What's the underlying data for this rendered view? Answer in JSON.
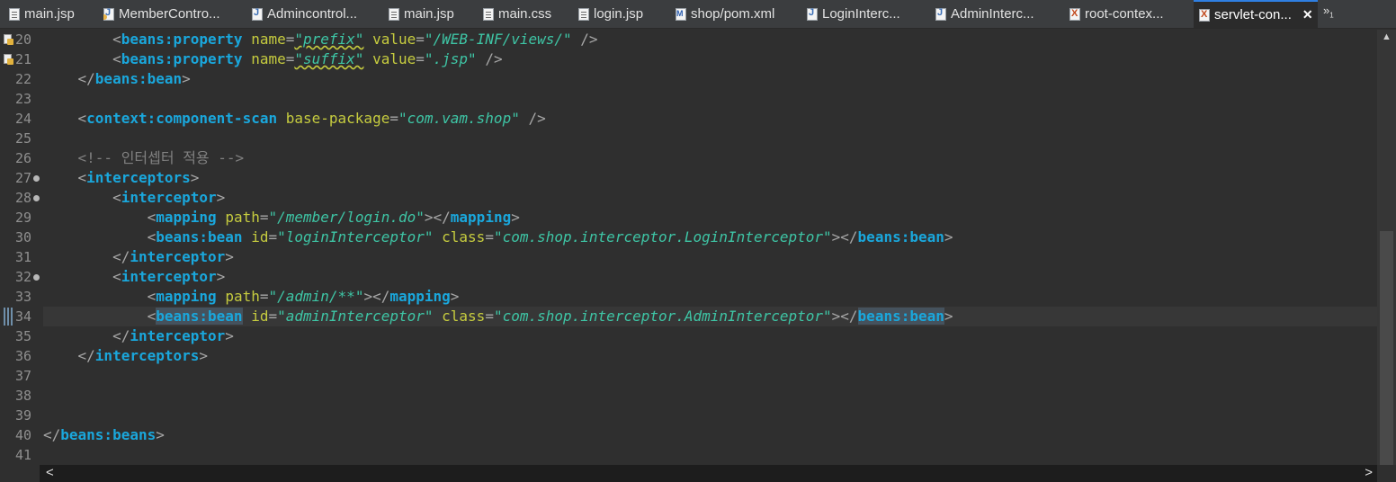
{
  "tabs": [
    {
      "label": "main.jsp",
      "icon": "jsp-file-icon"
    },
    {
      "label": "MemberContro...",
      "icon": "java-file-icon"
    },
    {
      "label": "Admincontrol...",
      "icon": "java-file-icon"
    },
    {
      "label": "main.jsp",
      "icon": "jsp-file-icon"
    },
    {
      "label": "main.css",
      "icon": "css-file-icon"
    },
    {
      "label": "login.jsp",
      "icon": "jsp-file-icon"
    },
    {
      "label": "shop/pom.xml",
      "icon": "maven-pom-icon"
    },
    {
      "label": "LoginInterc...",
      "icon": "java-file-icon"
    },
    {
      "label": "AdminInterc...",
      "icon": "java-file-icon"
    },
    {
      "label": "root-contex...",
      "icon": "xml-file-icon"
    },
    {
      "label": "servlet-con...",
      "icon": "xml-file-icon",
      "active": true
    }
  ],
  "overflow": {
    "symbol": "»",
    "count": "1"
  },
  "close_symbol": "✕",
  "line_numbers": [
    "20",
    "21",
    "22",
    "23",
    "24",
    "25",
    "26",
    "27",
    "28",
    "29",
    "30",
    "31",
    "32",
    "33",
    "34",
    "35",
    "36",
    "37",
    "38",
    "39",
    "40",
    "41"
  ],
  "code": {
    "l20": {
      "indent": "        ",
      "open": "<",
      "tag": "beans:property",
      "a1": "name",
      "v1": "\"prefix\"",
      "a2": "value",
      "v2": "\"/WEB-INF/views/\"",
      "close": " />"
    },
    "l21": {
      "indent": "        ",
      "open": "<",
      "tag": "beans:property",
      "a1": "name",
      "v1": "\"suffix\"",
      "a2": "value",
      "v2": "\".jsp\"",
      "close": " />"
    },
    "l22": {
      "indent": "    ",
      "open": "</",
      "tag": "beans:bean",
      "close": ">"
    },
    "l24": {
      "indent": "    ",
      "open": "<",
      "tag": "context:component-scan",
      "a1": "base-package",
      "v1": "\"com.vam.shop\"",
      "close": " />"
    },
    "l26": {
      "indent": "    ",
      "comment": "<!-- 인터셉터 적용 -->"
    },
    "l27": {
      "indent": "    ",
      "open": "<",
      "tag": "interceptors",
      "close": ">"
    },
    "l28": {
      "indent": "        ",
      "open": "<",
      "tag": "interceptor",
      "close": ">"
    },
    "l29": {
      "indent": "            ",
      "open": "<",
      "tag": "mapping",
      "a1": "path",
      "v1": "\"/member/login.do\"",
      "mid": "></",
      "tag2": "mapping",
      "close": ">"
    },
    "l30": {
      "indent": "            ",
      "open": "<",
      "tag": "beans:bean",
      "a1": "id",
      "v1": "\"loginInterceptor\"",
      "a2": "class",
      "v2": "\"com.shop.interceptor.LoginInterceptor\"",
      "mid": "></",
      "tag2": "beans:bean",
      "close": ">"
    },
    "l31": {
      "indent": "        ",
      "open": "</",
      "tag": "interceptor",
      "close": ">"
    },
    "l32": {
      "indent": "        ",
      "open": "<",
      "tag": "interceptor",
      "close": ">"
    },
    "l33": {
      "indent": "            ",
      "open": "<",
      "tag": "mapping",
      "a1": "path",
      "v1": "\"/admin/**\"",
      "mid": "></",
      "tag2": "mapping",
      "close": ">"
    },
    "l34": {
      "indent": "            ",
      "open": "<",
      "tag": "beans:bean",
      "a1": "id",
      "v1": "\"adminInterceptor\"",
      "a2": "class",
      "v2": "\"com.shop.interceptor.AdminInterceptor\"",
      "mid": "></",
      "tag2": "beans:bean",
      "close": ">"
    },
    "l35": {
      "indent": "        ",
      "open": "</",
      "tag": "interceptor",
      "close": ">"
    },
    "l36": {
      "indent": "    ",
      "open": "</",
      "tag": "interceptors",
      "close": ">"
    },
    "l40": {
      "indent": "",
      "open": "</",
      "tag": "beans:beans",
      "close": ">"
    }
  },
  "scroll": {
    "left_arrow": "<",
    "right_arrow": ">",
    "up_arrow": "▲"
  },
  "colors": {
    "tag": "#1aa7dc",
    "attribute": "#c6cc3f",
    "value": "#3ec5a5",
    "comment": "#808080",
    "bracket": "#a7a7a7",
    "background": "#2f2f2f",
    "active_tab_accent": "#2f7fe2"
  }
}
